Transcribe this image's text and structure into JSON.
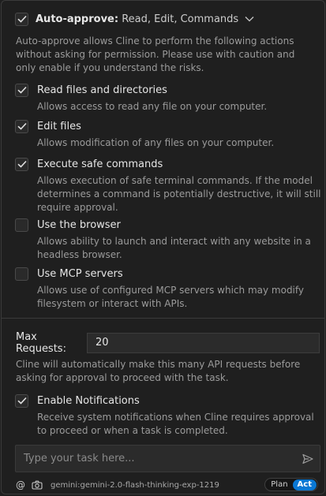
{
  "auto_approve": {
    "title": "Auto-approve:",
    "summary": "Read, Edit, Commands",
    "checked": true,
    "intro": "Auto-approve allows Cline to perform the following actions without asking for permission. Please use with caution and only enable if you understand the risks.",
    "options": [
      {
        "label": "Read files and directories",
        "description": "Allows access to read any file on your computer.",
        "checked": true
      },
      {
        "label": "Edit files",
        "description": "Allows modification of any files on your computer.",
        "checked": true
      },
      {
        "label": "Execute safe commands",
        "description": "Allows execution of safe terminal commands. If the model determines a command is potentially destructive, it will still require approval.",
        "checked": true
      },
      {
        "label": "Use the browser",
        "description": "Allows ability to launch and interact with any website in a headless browser.",
        "checked": false
      },
      {
        "label": "Use MCP servers",
        "description": "Allows use of configured MCP servers which may modify filesystem or interact with APIs.",
        "checked": false
      }
    ],
    "max_requests": {
      "label": "Max Requests:",
      "value": "20",
      "description": "Cline will automatically make this many API requests before asking for approval to proceed with the task."
    },
    "notifications": {
      "label": "Enable Notifications",
      "description": "Receive system notifications when Cline requires approval to proceed or when a task is completed.",
      "checked": true
    }
  },
  "task_input": {
    "placeholder": "Type your task here..."
  },
  "footer": {
    "mention_symbol": "@",
    "model": "gemini:gemini-2.0-flash-thinking-exp-1219",
    "modes": [
      {
        "label": "Plan",
        "active": false
      },
      {
        "label": "Act",
        "active": true
      }
    ]
  },
  "icons": {
    "checkmark": "check-icon",
    "chevron": "chevron-down-icon",
    "send": "send-icon",
    "camera": "camera-icon"
  },
  "colors": {
    "background": "#1f1f1f",
    "accent": "#0a78d4",
    "description_text": "#9b9b9b"
  }
}
